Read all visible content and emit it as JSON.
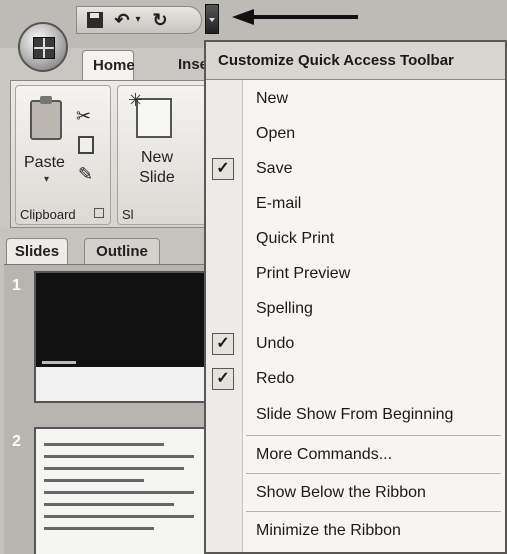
{
  "tabs": {
    "home": "Home",
    "insert": "Inse"
  },
  "ribbon": {
    "paste_label": "Paste",
    "new_slide_label_1": "New",
    "new_slide_label_2": "Slide",
    "clipboard_group": "Clipboard",
    "slides_group": "Sl"
  },
  "panel": {
    "slides_tab": "Slides",
    "outline_tab": "Outline",
    "slide_numbers": [
      "1",
      "2"
    ]
  },
  "menu": {
    "title": "Customize Quick Access Toolbar",
    "items": [
      {
        "label": "New",
        "checked": false
      },
      {
        "label": "Open",
        "checked": false
      },
      {
        "label": "Save",
        "checked": true
      },
      {
        "label": "E-mail",
        "checked": false
      },
      {
        "label": "Quick Print",
        "checked": false
      },
      {
        "label": "Print Preview",
        "checked": false
      },
      {
        "label": "Spelling",
        "checked": false
      },
      {
        "label": "Undo",
        "checked": true
      },
      {
        "label": "Redo",
        "checked": true
      },
      {
        "label": "Slide Show From Beginning",
        "checked": false
      }
    ],
    "more_commands": "More Commands...",
    "show_below": "Show Below the Ribbon",
    "minimize": "Minimize the Ribbon",
    "check_glyph": "✓"
  },
  "icons": {
    "office_button": "office-logo-icon",
    "save": "save-icon",
    "undo": "undo-icon",
    "redo": "redo-icon",
    "customize": "chevron-down-icon",
    "arrow": "left-arrow-icon"
  }
}
